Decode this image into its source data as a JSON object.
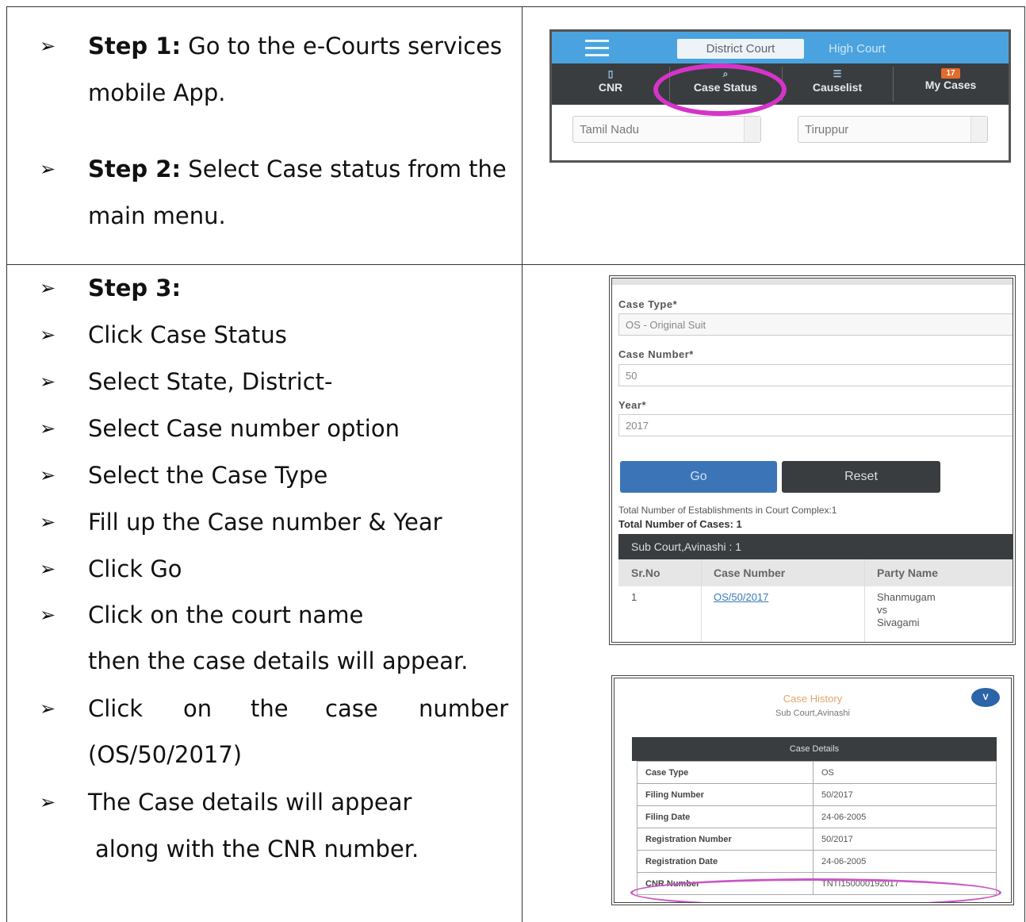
{
  "steps": {
    "step1_label": "Step 1:",
    "step1_text": " Go to the e-Courts services",
    "step1_cont": "mobile App.",
    "step2_label": "Step 2:",
    "step2_text": " Select Case status from the",
    "step2_cont": "main menu.",
    "step3_label": "Step 3:",
    "items": [
      "Click Case Status",
      "Select State, District-",
      "Select Case number option",
      "Select the Case Type",
      "Fill up the Case number & Year",
      "Click Go",
      "Click on the court name"
    ],
    "court_cont": "then the case details will appear.",
    "click_case_words": [
      "Click",
      "on",
      "the",
      "case",
      "number"
    ],
    "click_case_cont": "(OS/50/2017)",
    "details_item": "The Case details will appear",
    "details_cont": "along with the CNR number."
  },
  "screenshot1": {
    "tab_district": "District Court",
    "tab_high": "High Court",
    "nav": [
      {
        "label": "CNR",
        "icon": "id-icon"
      },
      {
        "label": "Case Status",
        "icon": "search-icon"
      },
      {
        "label": "Causelist",
        "icon": "list-icon"
      },
      {
        "label": "My Cases",
        "icon": "badge",
        "badge": "17"
      }
    ],
    "state": "Tamil Nadu",
    "district": "Tiruppur",
    "highlight_color": "#d633c8"
  },
  "screenshot2": {
    "case_type_label": "Case Type*",
    "case_type_value": "OS - Original Suit",
    "case_number_label": "Case Number*",
    "case_number_value": "50",
    "year_label": "Year*",
    "year_value": "2017",
    "go": "Go",
    "reset": "Reset",
    "total_establishments": "Total Number of Establishments in Court Complex:1",
    "total_cases": "Total Number of Cases: 1",
    "court_bar": "Sub Court,Avinashi : 1",
    "headers": [
      "Sr.No",
      "Case Number",
      "Party Name"
    ],
    "row": {
      "sr": "1",
      "case_number": "OS/50/2017",
      "party1": "Shanmugam",
      "vs": "vs",
      "party2": "Sivagami"
    }
  },
  "screenshot3": {
    "title": "Case History",
    "subtitle": "Sub Court,Avinashi",
    "badge": "V",
    "details_header": "Case Details",
    "rows": [
      {
        "key": "Case Type",
        "value": "OS"
      },
      {
        "key": "Filing Number",
        "value": "50/2017"
      },
      {
        "key": "Filing Date",
        "value": "24-06-2005"
      },
      {
        "key": "Registration Number",
        "value": "50/2017"
      },
      {
        "key": "Registration Date",
        "value": "24-06-2005"
      },
      {
        "key": "CNR Number",
        "value": "TNTI150000192017"
      }
    ]
  }
}
